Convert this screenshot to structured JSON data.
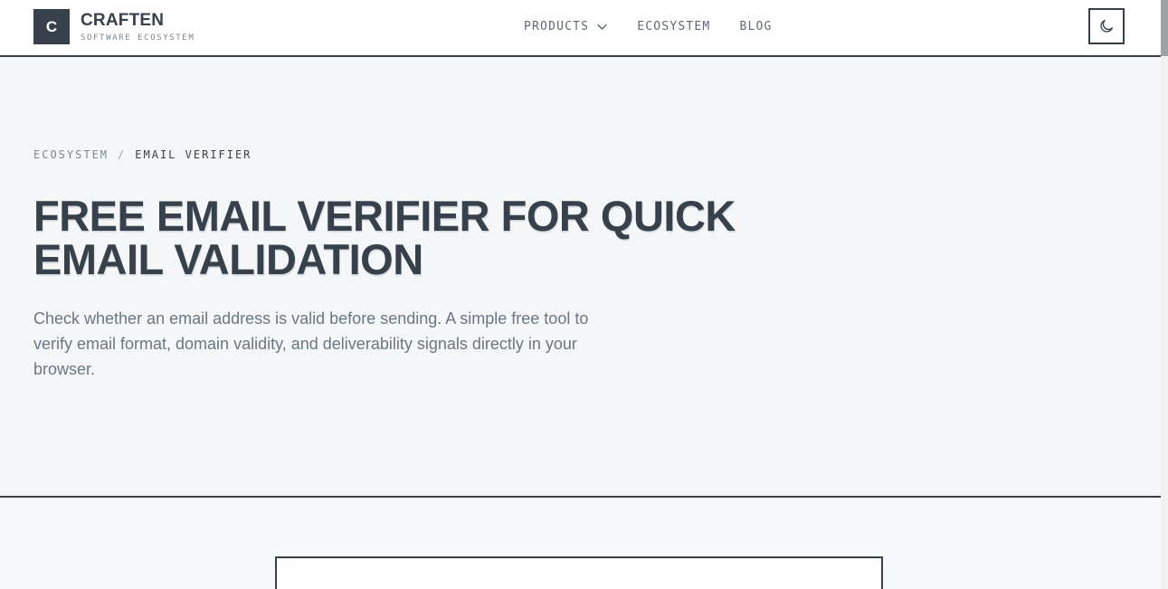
{
  "header": {
    "logo_letter": "C",
    "brand_name": "CRAFTEN",
    "brand_tagline": "SOFTWARE ECOSYSTEM",
    "nav": [
      {
        "label": "PRODUCTS",
        "has_dropdown": true
      },
      {
        "label": "ECOSYSTEM",
        "has_dropdown": false
      },
      {
        "label": "BLOG",
        "has_dropdown": false
      }
    ],
    "theme_icon": "moon-icon"
  },
  "hero": {
    "breadcrumb": {
      "parent": "ECOSYSTEM",
      "separator": "/",
      "current": "EMAIL VERIFIER"
    },
    "title": "FREE EMAIL VERIFIER FOR QUICK EMAIL VALIDATION",
    "description": "Check whether an email address is valid before sending. A simple free tool to verify email format, domain validity, and deliverability signals directly in your browser."
  },
  "colors": {
    "primary": "#36414b",
    "hero_bg": "#f4f6f8",
    "page_bg": "#f8f9fb",
    "muted_text": "#6a7784"
  }
}
